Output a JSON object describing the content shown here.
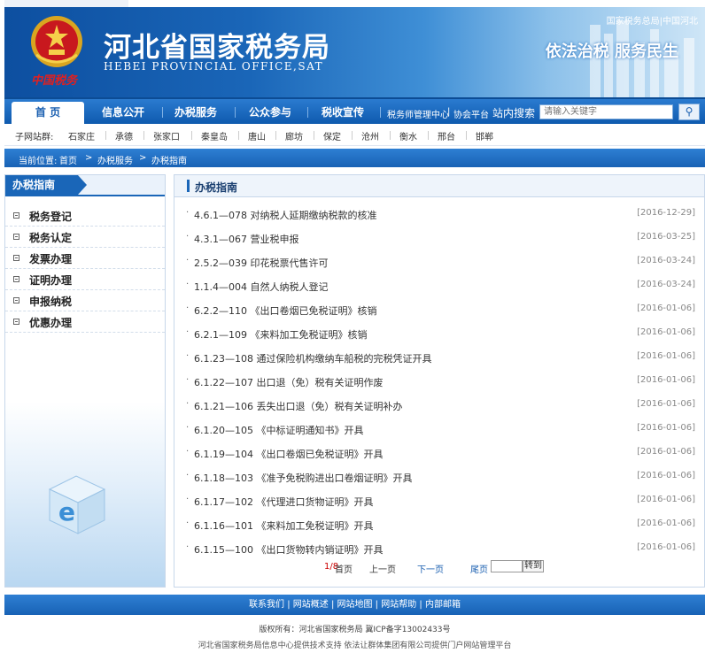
{
  "header": {
    "logo_text": "中国税务",
    "title_cn": "河北省国家税务局",
    "title_en": "HEBEI PROVINCIAL OFFICE,SAT",
    "top_links": "国家税务总局|中国河北",
    "slogan": "依法治税 服务民生"
  },
  "nav": {
    "home": "首 页",
    "items": [
      "信息公开",
      "办税服务",
      "公众参与",
      "税收宣传"
    ],
    "small_link_1": "税务师管理中心",
    "small_link_2": "协会平台",
    "search_label": "站内搜索",
    "search_placeholder": "请输入关键字"
  },
  "subsites": {
    "label": "子网站群:",
    "cities": [
      "石家庄",
      "承德",
      "张家口",
      "秦皇岛",
      "唐山",
      "廊坊",
      "保定",
      "沧州",
      "衡水",
      "邢台",
      "邯郸"
    ]
  },
  "breadcrumb": {
    "prefix": "当前位置:",
    "items": [
      "首页",
      "办税服务",
      "办税指南"
    ],
    "separator": ">"
  },
  "sidebar": {
    "title": "办税指南",
    "items": [
      "税务登记",
      "税务认定",
      "发票办理",
      "证明办理",
      "申报纳税",
      "优惠办理"
    ]
  },
  "main": {
    "title": "办税指南",
    "rows": [
      {
        "title": "4.6.1—078  对纳税人延期缴纳税款的核准",
        "date": "[2016-12-29]"
      },
      {
        "title": "4.3.1—067  营业税申报",
        "date": "[2016-03-25]"
      },
      {
        "title": "2.5.2—039  印花税票代售许可",
        "date": "[2016-03-24]"
      },
      {
        "title": "1.1.4—004 自然人纳税人登记",
        "date": "[2016-03-24]"
      },
      {
        "title": "6.2.2—110  《出口卷烟已免税证明》核销",
        "date": "[2016-01-06]"
      },
      {
        "title": "6.2.1—109  《来料加工免税证明》核销",
        "date": "[2016-01-06]"
      },
      {
        "title": "6.1.23—108  通过保险机构缴纳车船税的完税凭证开具",
        "date": "[2016-01-06]"
      },
      {
        "title": "6.1.22—107  出口退（免）税有关证明作废",
        "date": "[2016-01-06]"
      },
      {
        "title": "6.1.21—106  丢失出口退（免）税有关证明补办",
        "date": "[2016-01-06]"
      },
      {
        "title": "6.1.20—105  《中标证明通知书》开具",
        "date": "[2016-01-06]"
      },
      {
        "title": "6.1.19—104  《出口卷烟已免税证明》开具",
        "date": "[2016-01-06]"
      },
      {
        "title": "6.1.18—103  《准予免税购进出口卷烟证明》开具",
        "date": "[2016-01-06]"
      },
      {
        "title": "6.1.17—102  《代理进口货物证明》开具",
        "date": "[2016-01-06]"
      },
      {
        "title": "6.1.16—101  《来料加工免税证明》开具",
        "date": "[2016-01-06]"
      },
      {
        "title": "6.1.15—100  《出口货物转内销证明》开具",
        "date": "[2016-01-06]"
      }
    ]
  },
  "pager": {
    "page_info": "1/8",
    "first": "首页",
    "prev": "上一页",
    "next": "下一页",
    "last": "尾页",
    "go": "转到"
  },
  "footer": {
    "links": "联系我们 | 网站概述 | 网站地图 | 网站帮助 | 内部邮箱",
    "copyright": "版权所有：河北省国家税务局 冀ICP备字13002433号",
    "line2": "河北省国家税务局信息中心提供技术支持 依法让群体集团有限公司提供门户网站管理平台"
  },
  "colors": {
    "primary": "#1a66b8",
    "nav_dark": "#0f5aae",
    "logo_red": "#e02020"
  }
}
